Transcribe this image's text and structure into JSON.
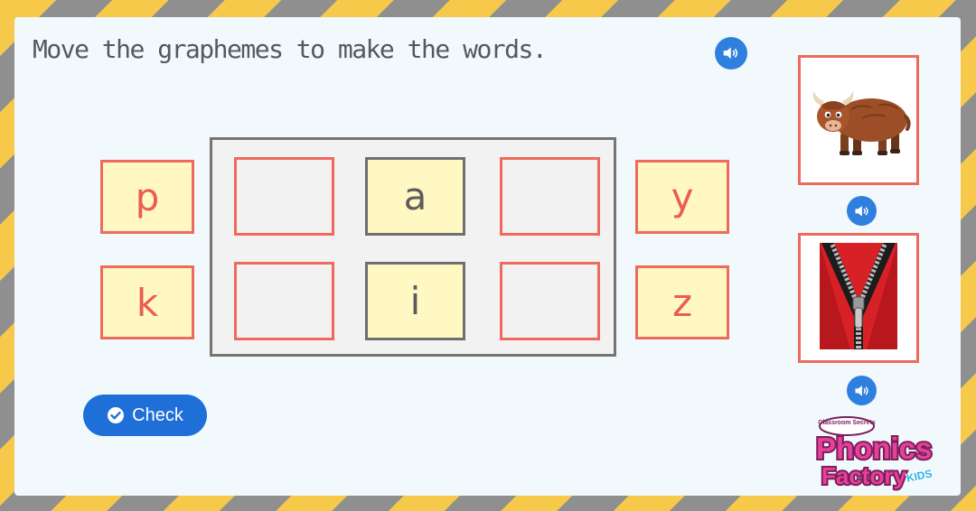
{
  "instruction": "Move the graphemes to make the words.",
  "icons": {
    "audio": "speaker-icon",
    "check": "check-circle-icon",
    "yak": "yak-picture",
    "zip": "zip-picture"
  },
  "colors": {
    "tile_fill": "#fff8c3",
    "tile_border": "#ee6a5d",
    "tile_text": "#ea5d50",
    "fixed_border": "#6f6f6f",
    "button_blue": "#1f6fd8",
    "audio_blue": "#2e7fde",
    "stripe_yellow": "#f6c94a",
    "stripe_grey": "#8f8f8f"
  },
  "grapheme_bank": {
    "left": [
      "p",
      "k"
    ],
    "right": [
      "y",
      "z"
    ]
  },
  "word_rows": [
    {
      "fixed_grapheme": "a",
      "slots": [
        "",
        ""
      ]
    },
    {
      "fixed_grapheme": "i",
      "slots": [
        "",
        ""
      ]
    }
  ],
  "check_button": {
    "label": "Check"
  },
  "logo": {
    "small_text": "Classroom Secrets",
    "line1": "Phonics",
    "line2": "Factory",
    "badge": "KIDS"
  }
}
